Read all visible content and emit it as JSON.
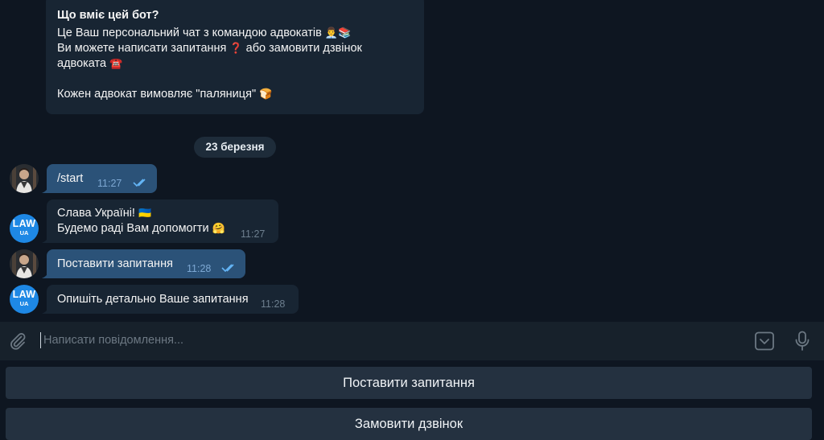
{
  "chat": {
    "intro_message": {
      "title": "Що вміє цей бот?",
      "line1": "Це Ваш персональний чат з командою адвокатів",
      "line1_emoji": "👨‍💼📚",
      "line2a": "Ви можете написати запитання",
      "line2_emoji": "❓",
      "line2b": "або замовити дзвінок",
      "line3": "адвоката",
      "line3_emoji": "☎️",
      "line4": "Кожен адвокат вимовляє \"паляниця\"",
      "line4_emoji": "🍞"
    },
    "date_separator": "23 березня",
    "messages": [
      {
        "from": "user",
        "text": "/start",
        "time": "11:27",
        "status": "read"
      },
      {
        "from": "bot",
        "line1": "Слава Україні!",
        "line1_emoji": "🇺🇦",
        "line2": "Будемо раді Вам допомогти",
        "line2_emoji": "🤗",
        "time": "11:27"
      },
      {
        "from": "user",
        "text": "Поставити запитання",
        "time": "11:28",
        "status": "read"
      },
      {
        "from": "bot",
        "text": "Опишіть детально Ваше запитання",
        "time": "11:28"
      }
    ],
    "bot_avatar": {
      "line1": "LAW",
      "line2": "UA"
    }
  },
  "composer": {
    "placeholder": "Написати повідомлення...",
    "icons": [
      "paperclip-icon",
      "bot-keyboard-icon",
      "microphone-icon"
    ]
  },
  "reply_keyboard": {
    "buttons": [
      "Поставити запитання",
      "Замовити дзвінок"
    ]
  },
  "colors": {
    "background": "#0e1621",
    "incoming_bubble": "#182533",
    "outgoing_bubble": "#2b5278",
    "composer": "#17212b",
    "keyboard_button": "#243140",
    "read_ticks": "#64b5f6"
  }
}
